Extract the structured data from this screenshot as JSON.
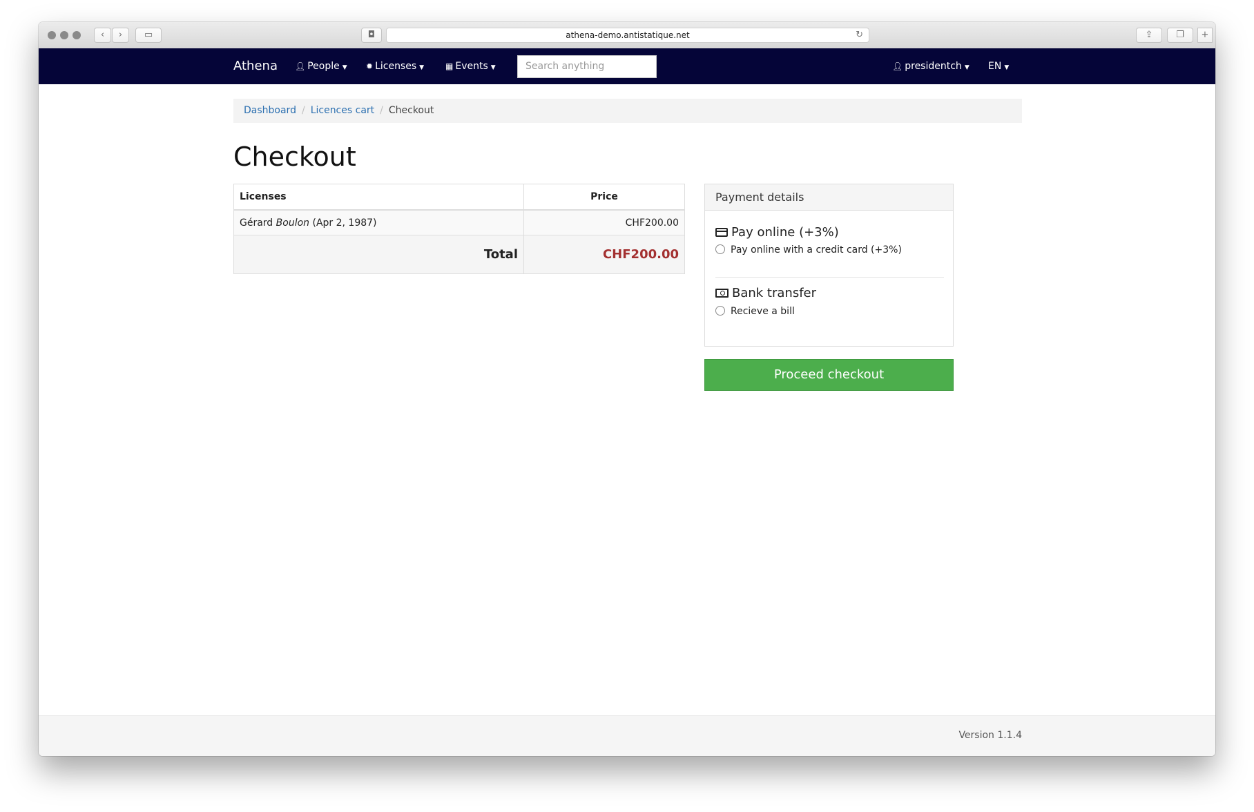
{
  "browser": {
    "url": "athena-demo.antistatique.net"
  },
  "navbar": {
    "brand": "Athena",
    "menus": [
      {
        "label": "People",
        "icon": "user-icon"
      },
      {
        "label": "Licenses",
        "icon": "certificate-icon"
      },
      {
        "label": "Events",
        "icon": "calendar-icon"
      }
    ],
    "search_placeholder": "Search anything",
    "user": "presidentch",
    "language": "EN"
  },
  "breadcrumb": {
    "items": [
      "Dashboard",
      "Licences cart",
      "Checkout"
    ]
  },
  "page_title": "Checkout",
  "cart": {
    "headers": [
      "Licenses",
      "Price"
    ],
    "rows": [
      {
        "first_name": "Gérard",
        "last_name": "Boulon",
        "date": "(Apr 2, 1987)",
        "price": "CHF200.00"
      }
    ],
    "total_label": "Total",
    "total_value": "CHF200.00"
  },
  "payment": {
    "title": "Payment details",
    "options": [
      {
        "title": "Pay online (+3%)",
        "radio_label": "Pay online with a credit card (+3%)",
        "icon": "credit-card-icon"
      },
      {
        "title": "Bank transfer",
        "radio_label": "Recieve a bill",
        "icon": "money-icon"
      }
    ],
    "submit_label": "Proceed checkout",
    "submit_color": "#4cae4c"
  },
  "footer": {
    "version": "Version 1.1.4"
  }
}
